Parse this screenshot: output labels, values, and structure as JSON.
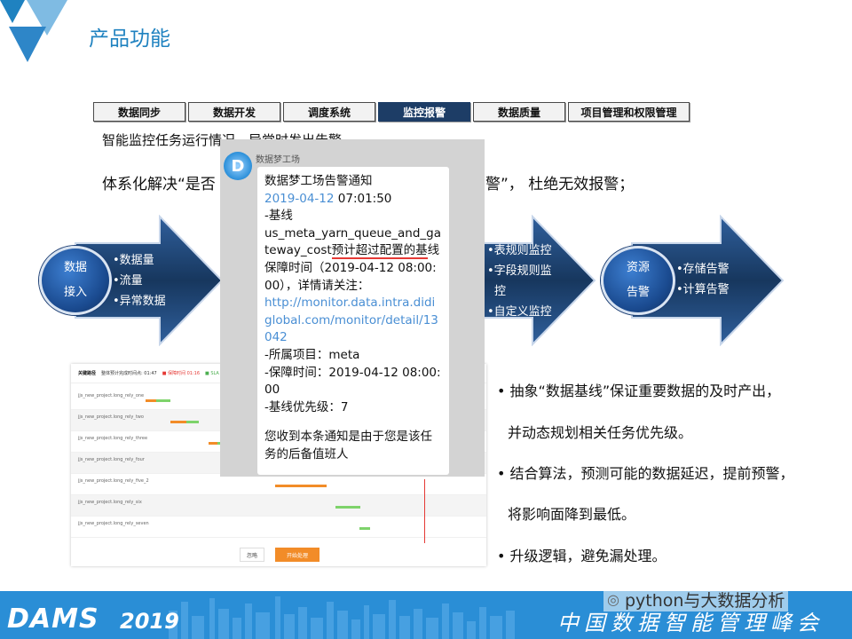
{
  "page_title": "产品功能",
  "tabs": [
    {
      "label": "数据同步",
      "active": false
    },
    {
      "label": "数据开发",
      "active": false
    },
    {
      "label": "调度系统",
      "active": false
    },
    {
      "label": "监控报警",
      "active": true
    },
    {
      "label": "数据质量",
      "active": false
    },
    {
      "label": "项目管理和权限管理",
      "active": false
    }
  ],
  "intro": {
    "line1": "智能监控任务运行情况，异常时发出告警",
    "line2_left": "体系化解决“是否",
    "line2_right": "警”， 杜绝无效报警；"
  },
  "arrow_left": {
    "oval_line1": "数据",
    "oval_line2": "接入",
    "items": [
      "•数据量",
      "•流量",
      "•异常数据"
    ]
  },
  "arrow_mid": {
    "items": [
      "•表规则监控",
      "•字段规则监",
      "控",
      "•自定义监控"
    ]
  },
  "arrow_right": {
    "oval_line1": "资源",
    "oval_line2": "告警",
    "items": [
      "•存储告警",
      "•计算告警"
    ]
  },
  "gantt": {
    "header_title": "关键路径",
    "header_note": "整体预计完成时间点: 01:47",
    "header_time": "01:47",
    "legend_1": "保障时间 01:16",
    "legend_2": "SLA",
    "rows": [
      {
        "name": "jjs_new_project.long_rely_one"
      },
      {
        "name": "jjs_new_project.long_rely_two"
      },
      {
        "name": "jjs_new_project.long_rely_three"
      },
      {
        "name": "jjs_new_project.long_rely_four"
      },
      {
        "name": "jjs_new_project.long_rely_five_2"
      },
      {
        "name": "jjs_new_project.long_rely_six"
      },
      {
        "name": "jjs_new_project.long_rely_seven"
      }
    ],
    "btn_ignore": "忽略",
    "btn_start": "开始处理"
  },
  "chat": {
    "sender": "数据梦工场",
    "avatar_letter": "D",
    "title": "数据梦工场告警通知",
    "date": "2019-04-12",
    "time": " 07:01:50",
    "baseline_label": "-基线",
    "baseline_name": "us_meta_yarn_queue_and_gateway_cost",
    "warning_text": "预计超过配置的基",
    "warning_tail": "线保障时间（2019-04-12 08:00:00），详情请关注：",
    "link": "http://monitor.data.intra.didiglobal.com/monitor/detail/13042",
    "project": "-所属项目：meta",
    "guarantee": "-保障时间：2019-04-12 08:00:00",
    "priority": "-基线优先级：7",
    "footer": "您收到本条通知是由于您是该任务的后备值班人"
  },
  "bullets": [
    "• 抽象“数据基线”保证重要数据的及时产出，",
    "并动态规划相关任务优先级。",
    "• 结合算法，预测可能的数据延迟，提前预警，",
    "将影响面降到最低。",
    "• 升级逻辑，避免漏处理。"
  ],
  "footer": {
    "brand": "DAMS",
    "year": "2019",
    "conference": "中国数据智能管理峰会",
    "wechat": "python与大数据分析"
  },
  "colors": {
    "title_blue": "#1f82c0",
    "tab_active": "#1d3d66",
    "arrow_dark": "#17375e",
    "footer_blue": "#2a8ed6",
    "alert_red": "#e53935",
    "link_blue": "#4a8fd4"
  }
}
